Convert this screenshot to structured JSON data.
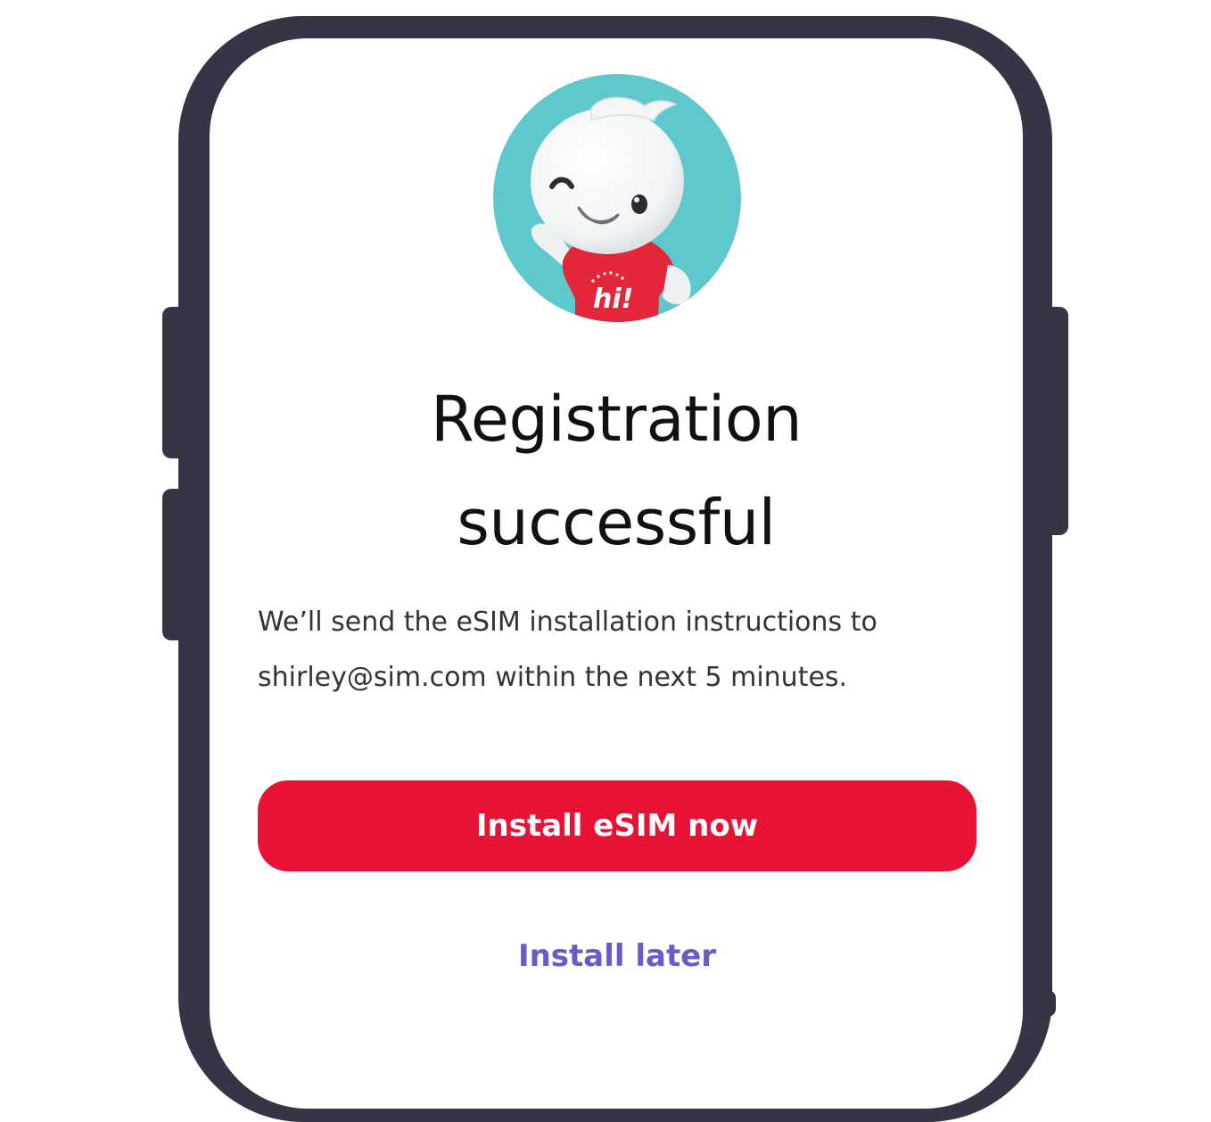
{
  "screen": {
    "title_line1": "Registration",
    "title_line2": "successful",
    "message_line1": "We’ll send the eSIM installation instructions to",
    "message_line2": "shirley@sim.com within the next 5 minutes.",
    "primary_button_label": "Install eSIM now",
    "secondary_link_label": "Install later",
    "mascot_shirt_text": "hi!"
  },
  "colors": {
    "phone_frame": "#353545",
    "primary_button": "#e81234",
    "secondary_link": "#6a59c9",
    "avatar_background": "#5ec8cc",
    "mascot_shirt": "#e3263a"
  }
}
